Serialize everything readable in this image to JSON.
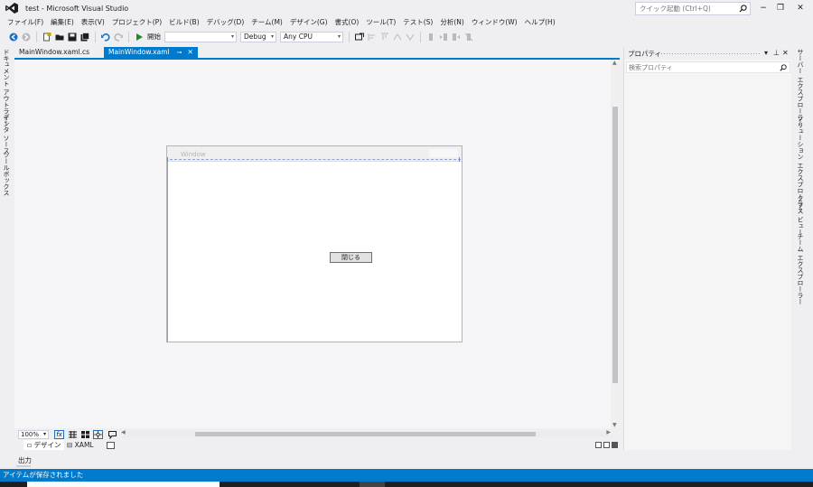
{
  "window": {
    "title": "test - Microsoft Visual Studio"
  },
  "quick_launch": {
    "placeholder": "クイック起動 (Ctrl+Q)"
  },
  "window_controls": {
    "minimize": "−",
    "maximize": "❐",
    "close": "✕"
  },
  "menu": [
    "ファイル(F)",
    "編集(E)",
    "表示(V)",
    "プロジェクト(P)",
    "ビルド(B)",
    "デバッグ(D)",
    "チーム(M)",
    "デザイン(G)",
    "書式(O)",
    "ツール(T)",
    "テスト(S)",
    "分析(N)",
    "ウィンドウ(W)",
    "ヘルプ(H)"
  ],
  "toolbar": {
    "start_label": "開始",
    "config": "Debug",
    "platform": "Any CPU"
  },
  "left_tabs": [
    "ドキュメント アウトライン",
    "データ ソース",
    "ツールボックス"
  ],
  "right_tabs": [
    "サーバー エクスプローラー",
    "ソリューション エクスプローラー",
    "クラス ビュー",
    "チーム エクスプローラー"
  ],
  "doc_tabs": [
    {
      "label": "MainWindow.xaml.cs",
      "active": false
    },
    {
      "label": "MainWindow.xaml",
      "active": true
    }
  ],
  "designer": {
    "window_title": "Window",
    "button_label": "閉じる",
    "zoom": "100%",
    "fx_label": "fx"
  },
  "split_tabs": {
    "design": "デザイン",
    "xaml": "XAML"
  },
  "output": {
    "label": "出力"
  },
  "properties": {
    "title": "プロパティ",
    "search_placeholder": "検索プロパティ"
  },
  "status": {
    "text": "アイテムが保存されました"
  },
  "colors": {
    "accent": "#007acc",
    "chrome": "#efeff2"
  }
}
